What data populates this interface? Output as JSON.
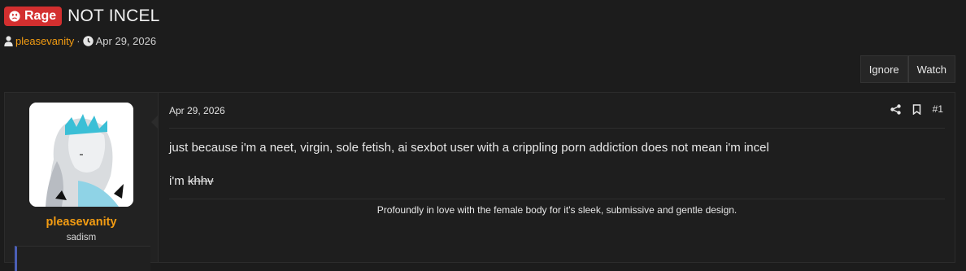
{
  "thread": {
    "prefix": "Rage",
    "title": "NOT INCEL",
    "author": "pleasevanity",
    "separator": "·",
    "date": "Apr 29, 2026"
  },
  "actions": {
    "ignore": "Ignore",
    "watch": "Watch"
  },
  "post": {
    "username": "pleasevanity",
    "user_title": "sadism",
    "date": "Apr 29, 2026",
    "number": "#1",
    "line1": "just because i'm a neet, virgin, sole fetish, ai sexbot user with a crippling porn addiction does not mean i'm incel",
    "line2_prefix": "i'm ",
    "line2_strike": "khhv",
    "signature": "Profoundly in love with the female body for it's sleek, submissive and gentle design."
  },
  "colors": {
    "prefix_bg": "#d32f2f",
    "username": "#f39c12",
    "background": "#1c1c1c"
  },
  "icons": [
    "angry-face-icon",
    "user-icon",
    "clock-icon",
    "share-icon",
    "bookmark-icon"
  ]
}
